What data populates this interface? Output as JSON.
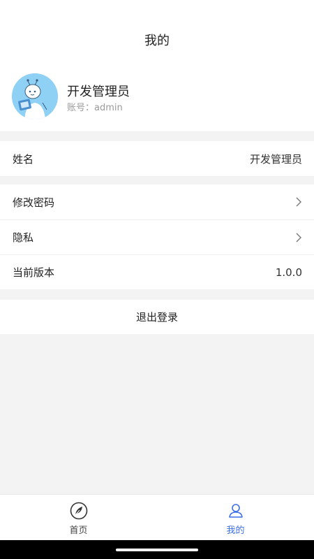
{
  "header": {
    "title": "我的"
  },
  "profile": {
    "name": "开发管理员",
    "account_label": "账号：",
    "account_value": "admin"
  },
  "info": {
    "name_label": "姓名",
    "name_value": "开发管理员"
  },
  "settings": {
    "change_password": "修改密码",
    "privacy": "隐私",
    "version_label": "当前版本",
    "version_value": "1.0.0"
  },
  "logout_label": "退出登录",
  "tabbar": {
    "home": "首页",
    "mine": "我的"
  },
  "colors": {
    "accent": "#3b6ee8",
    "background": "#f3f3f3",
    "avatar_bg": "#8fd0f5"
  },
  "icons": {
    "home": "leaf-circle-icon",
    "mine": "user-icon",
    "chevron": "chevron-right-icon"
  }
}
